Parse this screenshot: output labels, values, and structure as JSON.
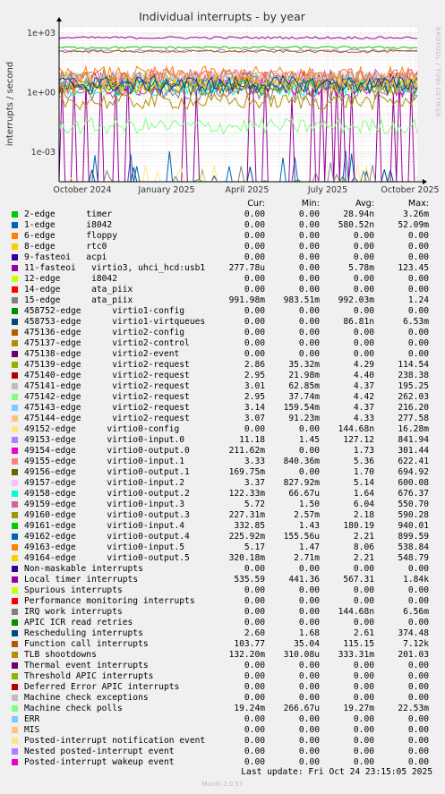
{
  "chart_data": {
    "type": "line",
    "title": "Individual interrupts - by year",
    "ylabel": "interrupts / second",
    "yscale": "log",
    "ylim": [
      3e-05,
      2000
    ],
    "y_ticks": [
      "1e+03",
      "1e+00",
      "1e-03"
    ],
    "x_ticks": [
      "October 2024",
      "January 2025",
      "April 2025",
      "July 2025",
      "October 2025"
    ],
    "grid": true,
    "columns": [
      "Cur:",
      "Min:",
      "Avg:",
      "Max:"
    ],
    "series": [
      {
        "name": "2-edge      timer",
        "color": "#00cc00",
        "cur": "0.00",
        "min": "0.00",
        "avg": "28.94n",
        "max": "3.26m"
      },
      {
        "name": "1-edge      i8042",
        "color": "#0066b3",
        "cur": "0.00",
        "min": "0.00",
        "avg": "580.52n",
        "max": "52.09m"
      },
      {
        "name": "6-edge      floppy",
        "color": "#ff8000",
        "cur": "0.00",
        "min": "0.00",
        "avg": "0.00",
        "max": "0.00"
      },
      {
        "name": "8-edge      rtc0",
        "color": "#ffcc00",
        "cur": "0.00",
        "min": "0.00",
        "avg": "0.00",
        "max": "0.00"
      },
      {
        "name": "9-fasteoi   acpi",
        "color": "#330099",
        "cur": "0.00",
        "min": "0.00",
        "avg": "0.00",
        "max": "0.00"
      },
      {
        "name": "11-fasteoi   virtio3, uhci_hcd:usb1",
        "color": "#990099",
        "cur": "277.78u",
        "min": "0.00",
        "avg": "5.78m",
        "max": "123.45"
      },
      {
        "name": "12-edge      i8042",
        "color": "#ccff00",
        "cur": "0.00",
        "min": "0.00",
        "avg": "0.00",
        "max": "0.00"
      },
      {
        "name": "14-edge      ata_piix",
        "color": "#ff0000",
        "cur": "0.00",
        "min": "0.00",
        "avg": "0.00",
        "max": "0.00"
      },
      {
        "name": "15-edge      ata_piix",
        "color": "#808080",
        "cur": "991.98m",
        "min": "983.51m",
        "avg": "992.03m",
        "max": "1.24"
      },
      {
        "name": "458752-edge      virtio1-config",
        "color": "#008f00",
        "cur": "0.00",
        "min": "0.00",
        "avg": "0.00",
        "max": "0.00"
      },
      {
        "name": "458753-edge      virtio1-virtqueues",
        "color": "#00487d",
        "cur": "0.00",
        "min": "0.00",
        "avg": "86.81n",
        "max": "6.53m"
      },
      {
        "name": "475136-edge      virtio2-config",
        "color": "#b35a00",
        "cur": "0.00",
        "min": "0.00",
        "avg": "0.00",
        "max": "0.00"
      },
      {
        "name": "475137-edge      virtio2-control",
        "color": "#b38f00",
        "cur": "0.00",
        "min": "0.00",
        "avg": "0.00",
        "max": "0.00"
      },
      {
        "name": "475138-edge      virtio2-event",
        "color": "#6b006b",
        "cur": "0.00",
        "min": "0.00",
        "avg": "0.00",
        "max": "0.00"
      },
      {
        "name": "475139-edge      virtio2-request",
        "color": "#8fb300",
        "cur": "2.86",
        "min": "35.32m",
        "avg": "4.29",
        "max": "114.54"
      },
      {
        "name": "475140-edge      virtio2-request",
        "color": "#b30000",
        "cur": "2.95",
        "min": "21.98m",
        "avg": "4.40",
        "max": "238.38"
      },
      {
        "name": "475141-edge      virtio2-request",
        "color": "#bebebe",
        "cur": "3.01",
        "min": "62.85m",
        "avg": "4.37",
        "max": "195.25"
      },
      {
        "name": "475142-edge      virtio2-request",
        "color": "#80ff80",
        "cur": "2.95",
        "min": "37.74m",
        "avg": "4.42",
        "max": "262.03"
      },
      {
        "name": "475143-edge      virtio2-request",
        "color": "#80c9ff",
        "cur": "3.14",
        "min": "159.54m",
        "avg": "4.37",
        "max": "216.20"
      },
      {
        "name": "475144-edge      virtio2-request",
        "color": "#ffc080",
        "cur": "3.07",
        "min": "91.23m",
        "avg": "4.33",
        "max": "277.58"
      },
      {
        "name": "49152-edge      virtio0-config",
        "color": "#ffe680",
        "cur": "0.00",
        "min": "0.00",
        "avg": "144.68n",
        "max": "16.28m"
      },
      {
        "name": "49153-edge      virtio0-input.0",
        "color": "#aa80ff",
        "cur": "11.18",
        "min": "1.45",
        "avg": "127.12",
        "max": "841.94"
      },
      {
        "name": "49154-edge      virtio0-output.0",
        "color": "#ee00cc",
        "cur": "211.62m",
        "min": "0.00",
        "avg": "1.73",
        "max": "301.44"
      },
      {
        "name": "49155-edge      virtio0-input.1",
        "color": "#ff8080",
        "cur": "3.33",
        "min": "840.36m",
        "avg": "5.36",
        "max": "622.41"
      },
      {
        "name": "49156-edge      virtio0-output.1",
        "color": "#666600",
        "cur": "169.75m",
        "min": "0.00",
        "avg": "1.70",
        "max": "694.92"
      },
      {
        "name": "49157-edge      virtio0-input.2",
        "color": "#ffbfff",
        "cur": "3.37",
        "min": "827.92m",
        "avg": "5.14",
        "max": "600.08"
      },
      {
        "name": "49158-edge      virtio0-output.2",
        "color": "#00ffcc",
        "cur": "122.33m",
        "min": "66.67u",
        "avg": "1.64",
        "max": "676.37"
      },
      {
        "name": "49159-edge      virtio0-input.3",
        "color": "#cc6699",
        "cur": "5.72",
        "min": "1.50",
        "avg": "6.04",
        "max": "550.70"
      },
      {
        "name": "49160-edge      virtio0-output.3",
        "color": "#999900",
        "cur": "227.31m",
        "min": "2.57m",
        "avg": "2.18",
        "max": "590.28"
      },
      {
        "name": "49161-edge      virtio0-input.4",
        "color": "#00cc00",
        "cur": "332.85",
        "min": "1.43",
        "avg": "180.19",
        "max": "940.01"
      },
      {
        "name": "49162-edge      virtio0-output.4",
        "color": "#0066b3",
        "cur": "225.92m",
        "min": "155.56u",
        "avg": "2.21",
        "max": "899.59"
      },
      {
        "name": "49163-edge      virtio0-input.5",
        "color": "#ff8000",
        "cur": "5.17",
        "min": "1.47",
        "avg": "8.06",
        "max": "538.84"
      },
      {
        "name": "49164-edge      virtio0-output.5",
        "color": "#ffcc00",
        "cur": "320.18m",
        "min": "2.71m",
        "avg": "2.21",
        "max": "548.79"
      },
      {
        "name": "Non-maskable interrupts",
        "color": "#330099",
        "cur": "0.00",
        "min": "0.00",
        "avg": "0.00",
        "max": "0.00"
      },
      {
        "name": "Local timer interrupts",
        "color": "#990099",
        "cur": "535.59",
        "min": "441.36",
        "avg": "567.31",
        "max": "1.84k"
      },
      {
        "name": "Spurious interrupts",
        "color": "#ccff00",
        "cur": "0.00",
        "min": "0.00",
        "avg": "0.00",
        "max": "0.00"
      },
      {
        "name": "Performance monitoring interrupts",
        "color": "#ff0000",
        "cur": "0.00",
        "min": "0.00",
        "avg": "0.00",
        "max": "0.00"
      },
      {
        "name": "IRQ work interrupts",
        "color": "#808080",
        "cur": "0.00",
        "min": "0.00",
        "avg": "144.68n",
        "max": "6.56m"
      },
      {
        "name": "APIC ICR read retries",
        "color": "#008f00",
        "cur": "0.00",
        "min": "0.00",
        "avg": "0.00",
        "max": "0.00"
      },
      {
        "name": "Rescheduling interrupts",
        "color": "#00487d",
        "cur": "2.60",
        "min": "1.68",
        "avg": "2.61",
        "max": "374.48"
      },
      {
        "name": "Function call interrupts",
        "color": "#b35a00",
        "cur": "103.77",
        "min": "35.04",
        "avg": "115.15",
        "max": "7.12k"
      },
      {
        "name": "TLB shootdowns",
        "color": "#b38f00",
        "cur": "132.20m",
        "min": "310.08u",
        "avg": "333.31m",
        "max": "201.03"
      },
      {
        "name": "Thermal event interrupts",
        "color": "#6b006b",
        "cur": "0.00",
        "min": "0.00",
        "avg": "0.00",
        "max": "0.00"
      },
      {
        "name": "Threshold APIC interrupts",
        "color": "#8fb300",
        "cur": "0.00",
        "min": "0.00",
        "avg": "0.00",
        "max": "0.00"
      },
      {
        "name": "Deferred Error APIC interrupts",
        "color": "#b30000",
        "cur": "0.00",
        "min": "0.00",
        "avg": "0.00",
        "max": "0.00"
      },
      {
        "name": "Machine check exceptions",
        "color": "#bebebe",
        "cur": "0.00",
        "min": "0.00",
        "avg": "0.00",
        "max": "0.00"
      },
      {
        "name": "Machine check polls",
        "color": "#80ff80",
        "cur": "19.24m",
        "min": "266.67u",
        "avg": "19.27m",
        "max": "22.53m"
      },
      {
        "name": "ERR",
        "color": "#80c9ff",
        "cur": "0.00",
        "min": "0.00",
        "avg": "0.00",
        "max": "0.00"
      },
      {
        "name": "MIS",
        "color": "#ffc080",
        "cur": "0.00",
        "min": "0.00",
        "avg": "0.00",
        "max": "0.00"
      },
      {
        "name": "Posted-interrupt notification event",
        "color": "#ffe680",
        "cur": "0.00",
        "min": "0.00",
        "avg": "0.00",
        "max": "0.00"
      },
      {
        "name": "Nested posted-interrupt event",
        "color": "#aa80ff",
        "cur": "0.00",
        "min": "0.00",
        "avg": "0.00",
        "max": "0.00"
      },
      {
        "name": "Posted-interrupt wakeup event",
        "color": "#ee00cc",
        "cur": "0.00",
        "min": "0.00",
        "avg": "0.00",
        "max": "0.00"
      }
    ]
  },
  "last_update": "Last update: Fri Oct 24 23:15:05 2025",
  "footer": "Munin 2.0.57",
  "side_label": "RRDTOOL / TOBI OETIKER"
}
